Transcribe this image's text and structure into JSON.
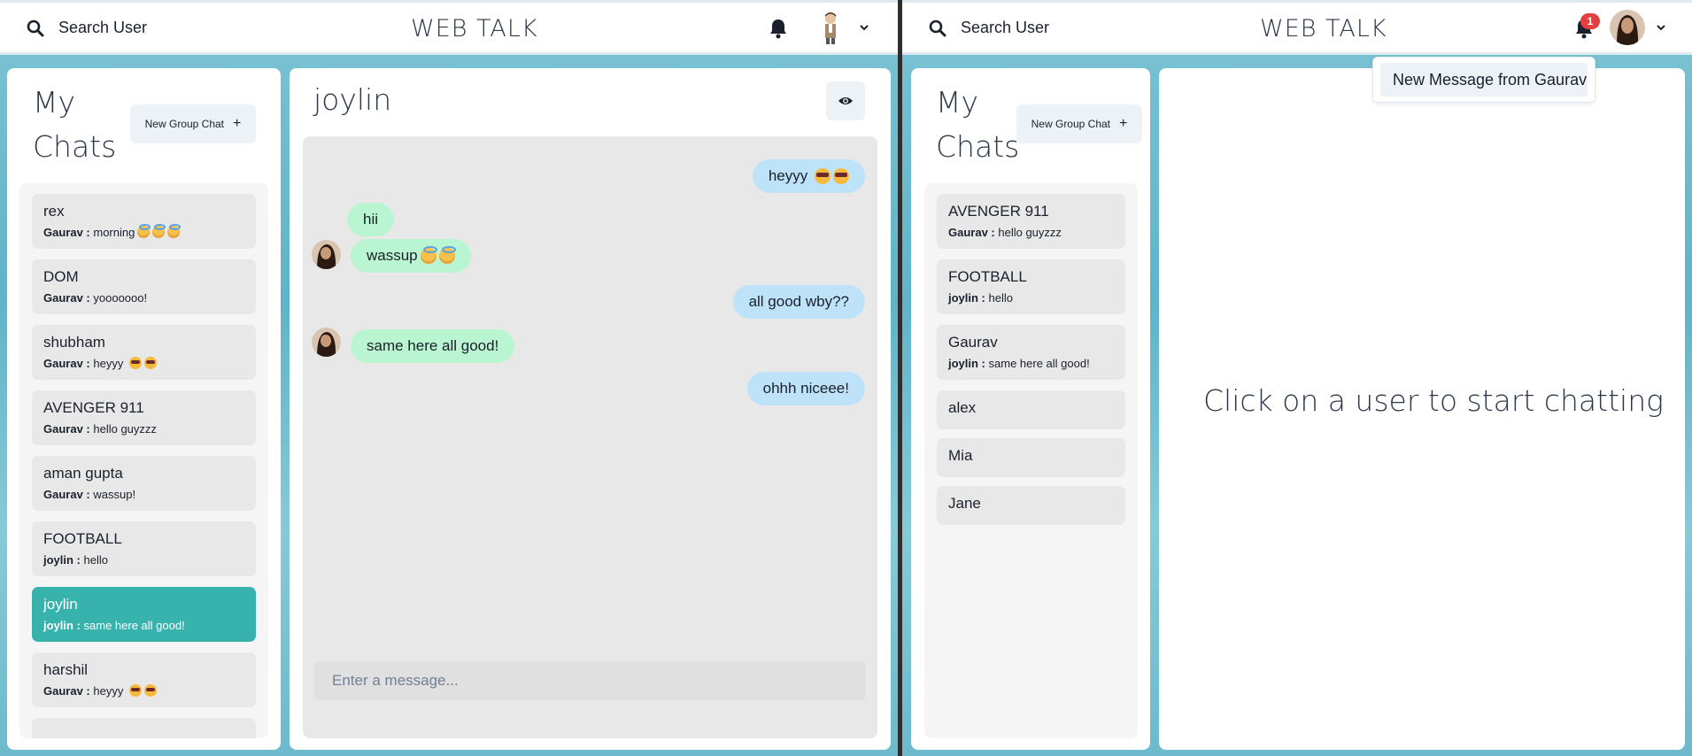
{
  "app": {
    "brand": "WEB TALK",
    "search_label": "Search User"
  },
  "left": {
    "sidebar": {
      "title": "My Chats",
      "new_group_label": "New Group Chat",
      "chats": [
        {
          "name": "rex",
          "sender": "Gaurav :",
          "text": "morning",
          "emoji": "angel x3"
        },
        {
          "name": "DOM",
          "sender": "Gaurav :",
          "text": "yooooooo!"
        },
        {
          "name": "shubham",
          "sender": "Gaurav :",
          "text": "heyyy",
          "emoji": "cool x2"
        },
        {
          "name": "AVENGER 911",
          "sender": "Gaurav :",
          "text": "hello guyzzz"
        },
        {
          "name": "aman gupta",
          "sender": "Gaurav :",
          "text": "wassup!"
        },
        {
          "name": "FOOTBALL",
          "sender": "joylin :",
          "text": "hello"
        },
        {
          "name": "joylin",
          "sender": "joylin :",
          "text": "same here all good!",
          "active": true
        },
        {
          "name": "harshil",
          "sender": "Gaurav :",
          "text": "heyyy",
          "emoji": "cool x2"
        }
      ]
    },
    "chat": {
      "name": "joylin",
      "messages": [
        {
          "from": "me",
          "text": "heyyy",
          "emoji": "cool x2"
        },
        {
          "from": "them",
          "text": "hii"
        },
        {
          "from": "them",
          "text": "wassup",
          "emoji": "angel x2"
        },
        {
          "from": "me",
          "text": "all good wby??"
        },
        {
          "from": "them",
          "text": "same here all good!"
        },
        {
          "from": "me",
          "text": "ohhh niceee!"
        }
      ],
      "input_placeholder": "Enter a message..."
    }
  },
  "right": {
    "notification_count": "1",
    "notification": "New Message from Gaurav",
    "sidebar": {
      "title": "My Chats",
      "new_group_label": "New Group Chat",
      "chats": [
        {
          "name": "AVENGER 911",
          "sender": "Gaurav :",
          "text": "hello guyzzz"
        },
        {
          "name": "FOOTBALL",
          "sender": "joylin :",
          "text": "hello"
        },
        {
          "name": "Gaurav",
          "sender": "joylin :",
          "text": "same here all good!"
        },
        {
          "name": "alex"
        },
        {
          "name": "Mia"
        },
        {
          "name": "Jane"
        }
      ]
    },
    "empty_state": "Click on a user to start chatting"
  },
  "colors": {
    "active_chat": "#38b2ac",
    "my_bubble": "#bee3f8",
    "their_bubble": "#b9f5d0",
    "badge": "#e53e3e"
  }
}
